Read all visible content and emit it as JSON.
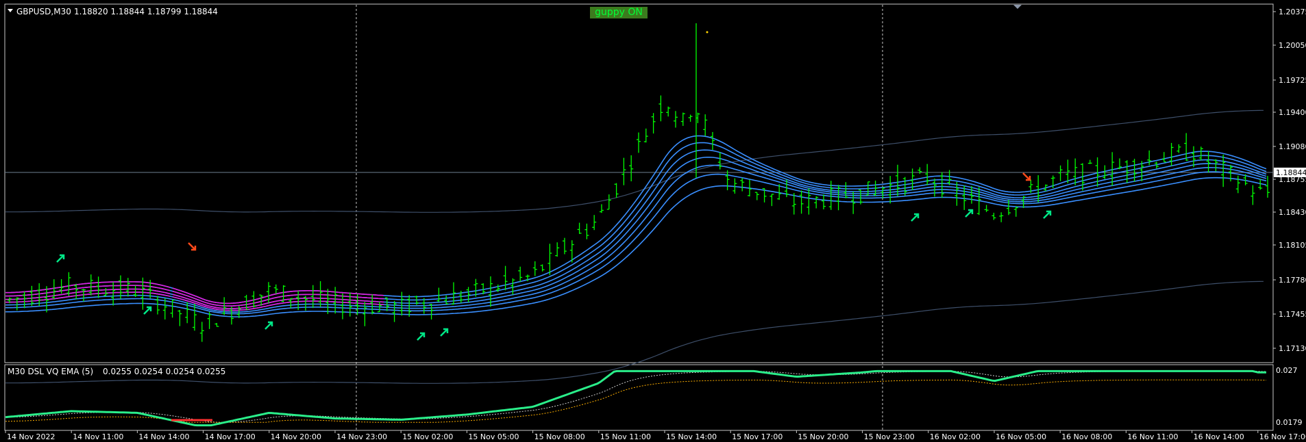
{
  "main_header": {
    "symbol": "GBPUSD,M30",
    "ohlc": "1.18820 1.18844 1.18799 1.18844"
  },
  "guppy_badge": "guppy ON",
  "current_price_label": "1.18844",
  "price_axis": [
    "1.20375",
    "1.20050",
    "1.19725",
    "1.19400",
    "1.19080",
    "1.18755",
    "1.18430",
    "1.18105",
    "1.17780",
    "1.17455",
    "1.17130"
  ],
  "sub_header": {
    "title": "M30 DSL  VQ  EMA (5)",
    "values": "0.0255 0.0254 0.0254 0.0255"
  },
  "sub_axis": [
    "0.027",
    "0.0179"
  ],
  "time_axis": [
    "14 Nov 2022",
    "14 Nov 11:00",
    "14 Nov 14:00",
    "14 Nov 17:00",
    "14 Nov 20:00",
    "14 Nov 23:00",
    "15 Nov 02:00",
    "15 Nov 05:00",
    "15 Nov 08:00",
    "15 Nov 11:00",
    "15 Nov 14:00",
    "15 Nov 17:00",
    "15 Nov 20:00",
    "15 Nov 23:00",
    "16 Nov 02:00",
    "16 Nov 05:00",
    "16 Nov 08:00",
    "16 Nov 11:00",
    "16 Nov 14:00",
    "16 Nov 17:00"
  ],
  "colors": {
    "background": "#000000",
    "bars": "#00ff00",
    "ribbon_blue": "#3a8fff",
    "ribbon_magenta": "#e020e0",
    "envelope": "#3e4f6a",
    "arrow_up": "#00e887",
    "arrow_down": "#ff4a1a",
    "grid_divider": "#c8c8c8"
  },
  "chart_data": {
    "type": "line",
    "title": "GBPUSD,M30",
    "x": [
      "14 Nov 2022",
      "14 Nov 11:00",
      "14 Nov 14:00",
      "14 Nov 17:00",
      "14 Nov 20:00",
      "14 Nov 23:00",
      "15 Nov 02:00",
      "15 Nov 05:00",
      "15 Nov 08:00",
      "15 Nov 11:00",
      "15 Nov 14:00",
      "15 Nov 17:00",
      "15 Nov 20:00",
      "15 Nov 23:00",
      "16 Nov 02:00",
      "16 Nov 05:00",
      "16 Nov 08:00",
      "16 Nov 11:00",
      "16 Nov 14:00",
      "16 Nov 17:00"
    ],
    "ylim": [
      1.171,
      1.2045
    ],
    "series": [
      {
        "values": [
          1.1766,
          1.178,
          1.1776,
          1.1743,
          1.1776,
          1.1763,
          1.176,
          1.1772,
          1.179,
          1.1845,
          1.196,
          1.188,
          1.186,
          1.187,
          1.1885,
          1.185,
          1.1885,
          1.1895,
          1.191,
          1.187
        ]
      }
    ]
  }
}
